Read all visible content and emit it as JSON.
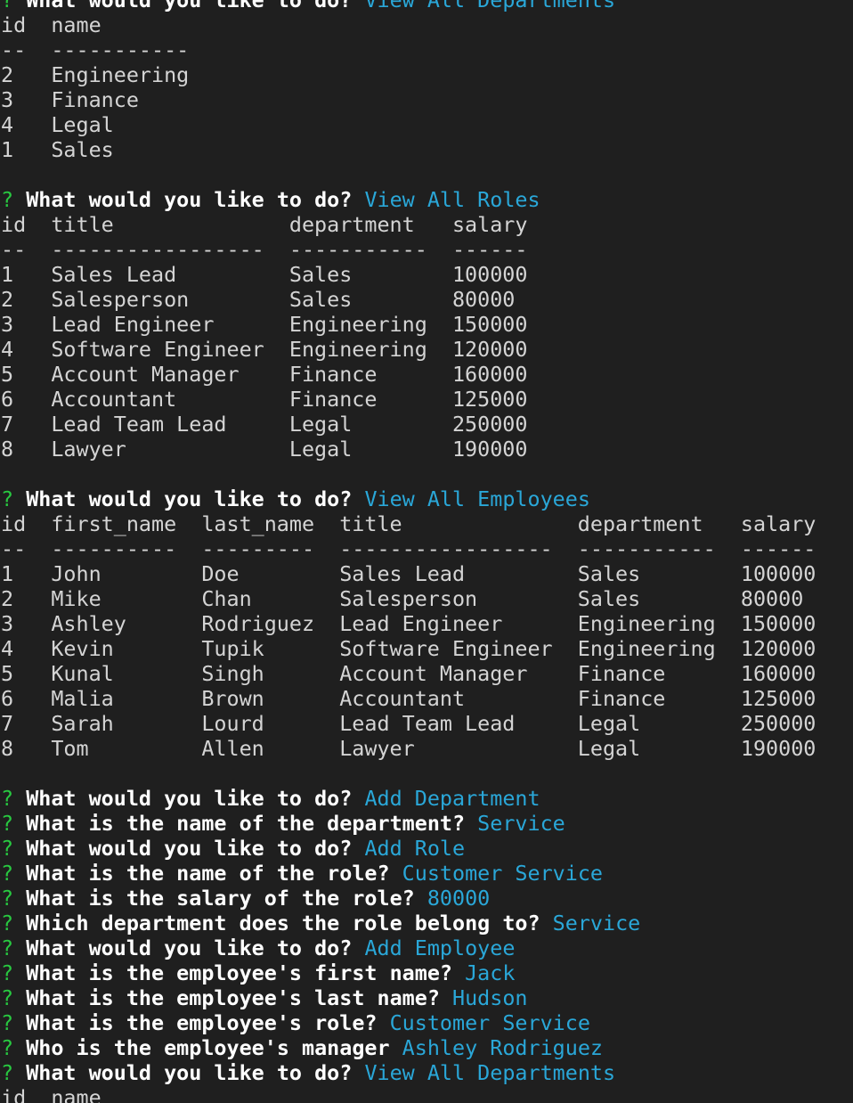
{
  "theme": {
    "background": "#1f1f1f",
    "text": "#d4d4d4",
    "question_mark": "#28c840",
    "prompt": "#ffffff",
    "answer": "#2aa7d8"
  },
  "lines": [
    {
      "type": "prompt",
      "mark": "?",
      "question": "What would you like to do?",
      "answer": "View All Departments"
    },
    {
      "type": "text",
      "text": "id  name"
    },
    {
      "type": "text",
      "text": "--  -----------"
    },
    {
      "type": "text",
      "text": "2   Engineering"
    },
    {
      "type": "text",
      "text": "3   Finance"
    },
    {
      "type": "text",
      "text": "4   Legal"
    },
    {
      "type": "text",
      "text": "1   Sales"
    },
    {
      "type": "text",
      "text": ""
    },
    {
      "type": "prompt",
      "mark": "?",
      "question": "What would you like to do?",
      "answer": "View All Roles"
    },
    {
      "type": "text",
      "text": "id  title              department   salary"
    },
    {
      "type": "text",
      "text": "--  -----------------  -----------  ------"
    },
    {
      "type": "text",
      "text": "1   Sales Lead         Sales        100000"
    },
    {
      "type": "text",
      "text": "2   Salesperson        Sales        80000"
    },
    {
      "type": "text",
      "text": "3   Lead Engineer      Engineering  150000"
    },
    {
      "type": "text",
      "text": "4   Software Engineer  Engineering  120000"
    },
    {
      "type": "text",
      "text": "5   Account Manager    Finance      160000"
    },
    {
      "type": "text",
      "text": "6   Accountant         Finance      125000"
    },
    {
      "type": "text",
      "text": "7   Lead Team Lead     Legal        250000"
    },
    {
      "type": "text",
      "text": "8   Lawyer             Legal        190000"
    },
    {
      "type": "text",
      "text": ""
    },
    {
      "type": "prompt",
      "mark": "?",
      "question": "What would you like to do?",
      "answer": "View All Employees"
    },
    {
      "type": "text",
      "text": "id  first_name  last_name  title              department   salary"
    },
    {
      "type": "text",
      "text": "--  ----------  ---------  -----------------  -----------  ------"
    },
    {
      "type": "text",
      "text": "1   John        Doe        Sales Lead         Sales        100000"
    },
    {
      "type": "text",
      "text": "2   Mike        Chan       Salesperson        Sales        80000"
    },
    {
      "type": "text",
      "text": "3   Ashley      Rodriguez  Lead Engineer      Engineering  150000"
    },
    {
      "type": "text",
      "text": "4   Kevin       Tupik      Software Engineer  Engineering  120000"
    },
    {
      "type": "text",
      "text": "5   Kunal       Singh      Account Manager    Finance      160000"
    },
    {
      "type": "text",
      "text": "6   Malia       Brown      Accountant         Finance      125000"
    },
    {
      "type": "text",
      "text": "7   Sarah       Lourd      Lead Team Lead     Legal        250000"
    },
    {
      "type": "text",
      "text": "8   Tom         Allen      Lawyer             Legal        190000"
    },
    {
      "type": "text",
      "text": ""
    },
    {
      "type": "prompt",
      "mark": "?",
      "question": "What would you like to do?",
      "answer": "Add Department"
    },
    {
      "type": "prompt",
      "mark": "?",
      "question": "What is the name of the department?",
      "answer": "Service"
    },
    {
      "type": "prompt",
      "mark": "?",
      "question": "What would you like to do?",
      "answer": "Add Role"
    },
    {
      "type": "prompt",
      "mark": "?",
      "question": "What is the name of the role?",
      "answer": "Customer Service"
    },
    {
      "type": "prompt",
      "mark": "?",
      "question": "What is the salary of the role?",
      "answer": "80000"
    },
    {
      "type": "prompt",
      "mark": "?",
      "question": "Which department does the role belong to?",
      "answer": "Service"
    },
    {
      "type": "prompt",
      "mark": "?",
      "question": "What would you like to do?",
      "answer": "Add Employee"
    },
    {
      "type": "prompt",
      "mark": "?",
      "question": "What is the employee's first name?",
      "answer": "Jack"
    },
    {
      "type": "prompt",
      "mark": "?",
      "question": "What is the employee's last name?",
      "answer": "Hudson"
    },
    {
      "type": "prompt",
      "mark": "?",
      "question": "What is the employee's role?",
      "answer": "Customer Service"
    },
    {
      "type": "prompt",
      "mark": "?",
      "question": "Who is the employee's manager",
      "answer": "Ashley Rodriguez"
    },
    {
      "type": "prompt",
      "mark": "?",
      "question": "What would you like to do?",
      "answer": "View All Departments"
    },
    {
      "type": "text",
      "text": "id  name"
    }
  ]
}
